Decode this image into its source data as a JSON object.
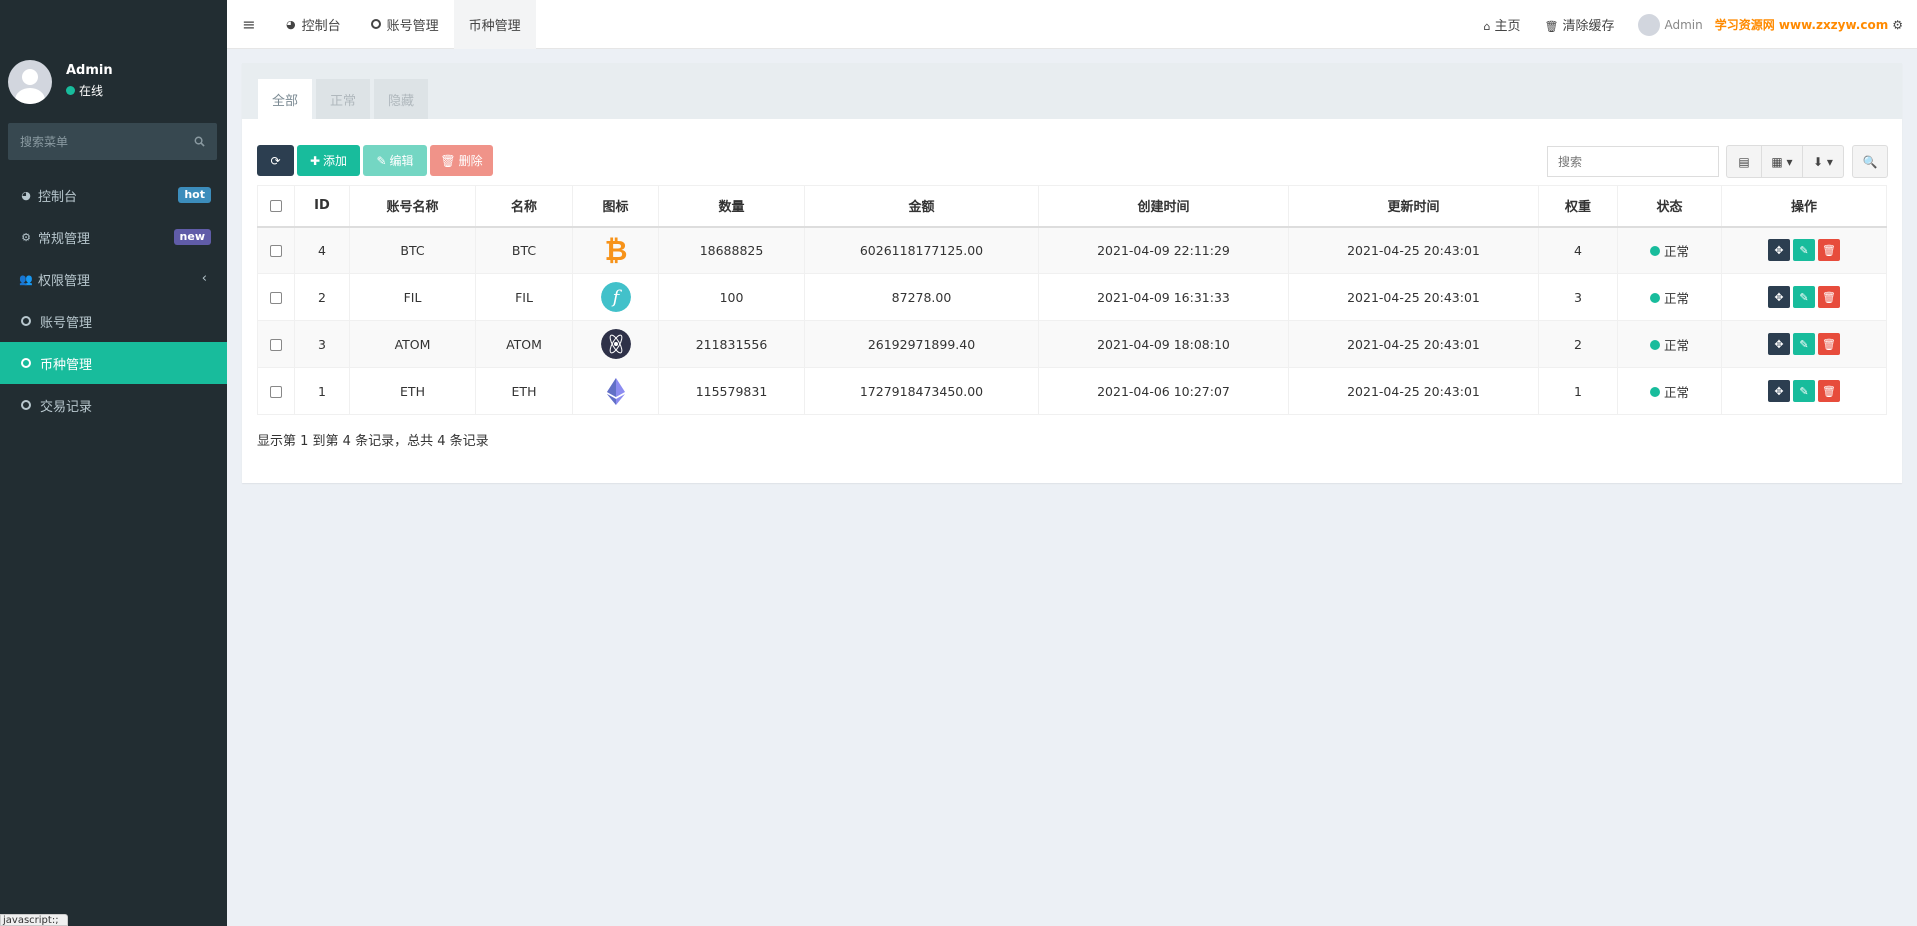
{
  "sidebar": {
    "user": {
      "name": "Admin",
      "status": "在线"
    },
    "search_placeholder": "搜索菜单",
    "items": [
      {
        "label": "控制台",
        "badge": "hot"
      },
      {
        "label": "常规管理",
        "badge": "new"
      },
      {
        "label": "权限管理"
      },
      {
        "label": "账号管理"
      },
      {
        "label": "币种管理"
      },
      {
        "label": "交易记录"
      }
    ],
    "status_bar": "javascript:;"
  },
  "header": {
    "tabs": [
      "控制台",
      "账号管理",
      "币种管理"
    ],
    "links": {
      "home": "主页",
      "clear_cache": "清除缓存",
      "user": "Admin"
    },
    "watermark": "学习资源网 www.zxzyw.com"
  },
  "panel": {
    "tabs": [
      "全部",
      "正常",
      "隐藏"
    ],
    "toolbar": {
      "add": "添加",
      "edit": "编辑",
      "delete": "删除",
      "search_placeholder": "搜索"
    },
    "columns": [
      "ID",
      "账号名称",
      "名称",
      "图标",
      "数量",
      "金额",
      "创建时间",
      "更新时间",
      "权重",
      "状态",
      "操作"
    ],
    "rows": [
      {
        "id": "4",
        "account": "BTC",
        "name": "BTC",
        "icon": "bitcoin-icon",
        "qty": "18688825",
        "amount": "6026118177125.00",
        "created": "2021-04-09 22:11:29",
        "updated": "2021-04-25 20:43:01",
        "weight": "4",
        "status": "正常"
      },
      {
        "id": "2",
        "account": "FIL",
        "name": "FIL",
        "icon": "filecoin-icon",
        "qty": "100",
        "amount": "87278.00",
        "created": "2021-04-09 16:31:33",
        "updated": "2021-04-25 20:43:01",
        "weight": "3",
        "status": "正常"
      },
      {
        "id": "3",
        "account": "ATOM",
        "name": "ATOM",
        "icon": "cosmos-icon",
        "qty": "211831556",
        "amount": "26192971899.40",
        "created": "2021-04-09 18:08:10",
        "updated": "2021-04-25 20:43:01",
        "weight": "2",
        "status": "正常"
      },
      {
        "id": "1",
        "account": "ETH",
        "name": "ETH",
        "icon": "ethereum-icon",
        "qty": "115579831",
        "amount": "1727918473450.00",
        "created": "2021-04-06 10:27:07",
        "updated": "2021-04-25 20:43:01",
        "weight": "1",
        "status": "正常"
      }
    ],
    "page_info": "显示第 1 到第 4 条记录，总共 4 条记录"
  },
  "colors": {
    "sidebar_bg": "#222d32",
    "accent": "#18bc9c",
    "danger": "#e74c3c",
    "dark": "#2c3e50"
  }
}
